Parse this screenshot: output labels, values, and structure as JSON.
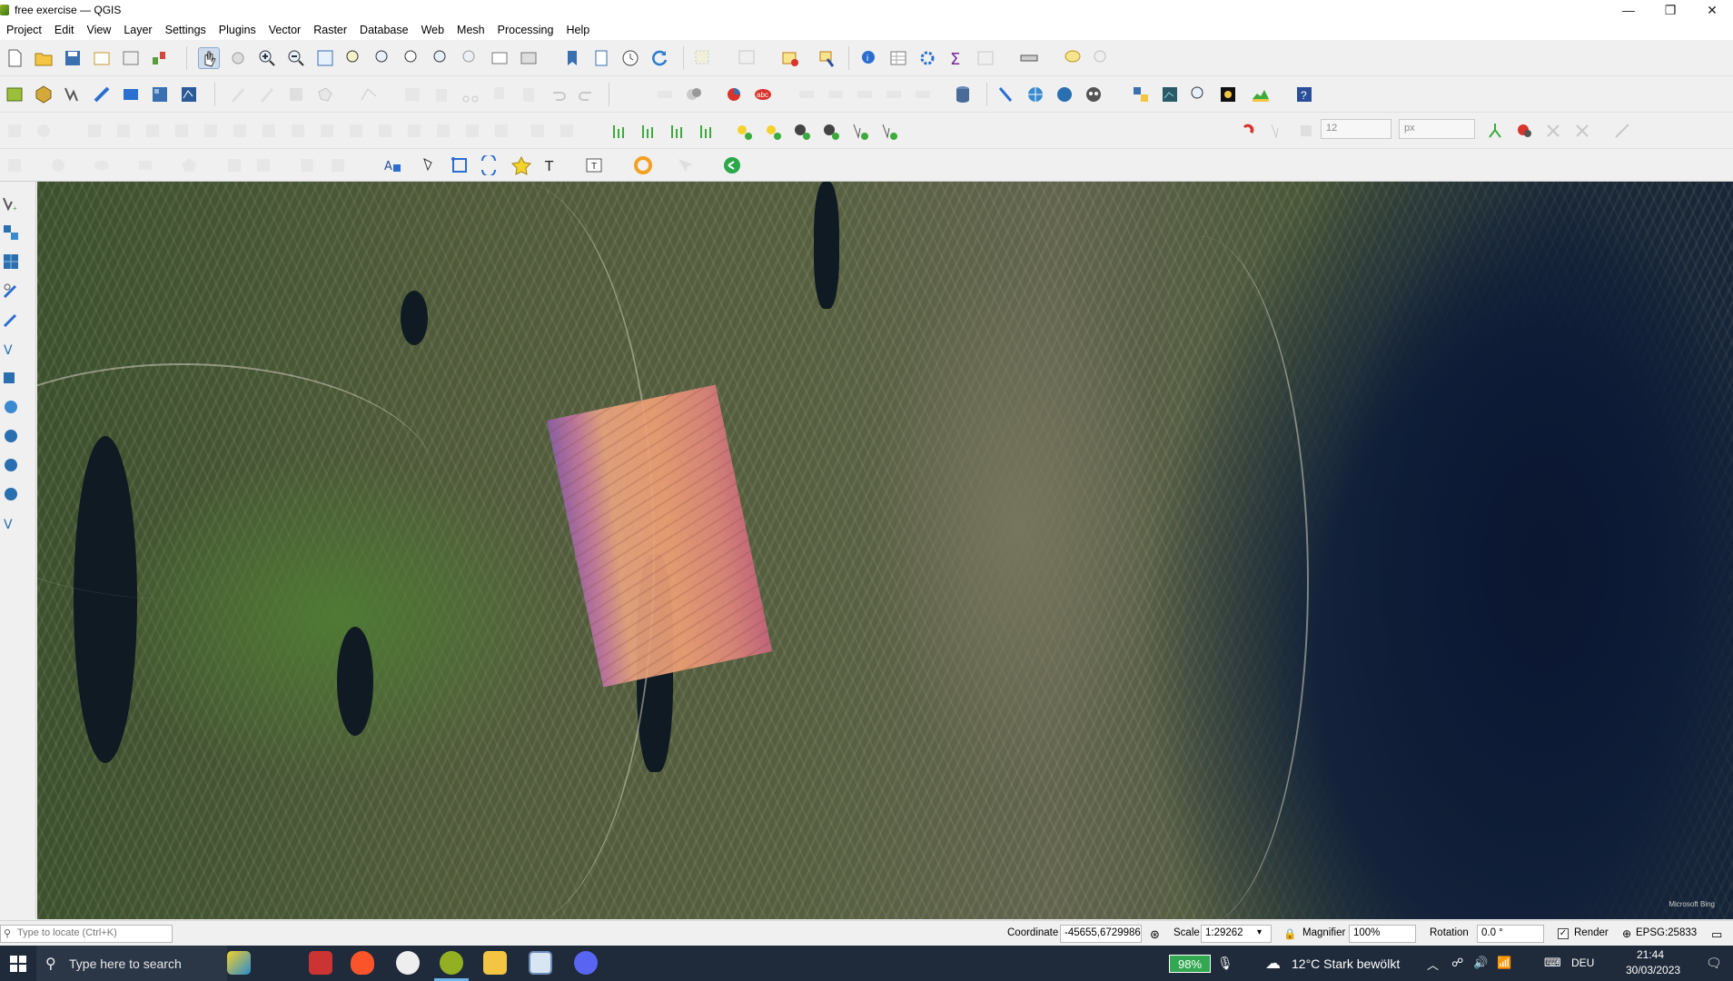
{
  "window": {
    "title": "free exercise — QGIS",
    "minimize": "—",
    "maximize": "❐",
    "close": "✕"
  },
  "menu": [
    "Project",
    "Edit",
    "View",
    "Layer",
    "Settings",
    "Plugins",
    "Vector",
    "Raster",
    "Database",
    "Web",
    "Mesh",
    "Processing",
    "Help"
  ],
  "digitizing": {
    "snap_value": "12",
    "snap_unit": "px"
  },
  "map": {
    "attribution": "Microsoft Bing"
  },
  "status": {
    "locate_placeholder": "Type to locate (Ctrl+K)",
    "coordinate_label": "Coordinate",
    "coordinate_value": "-45655,6729986",
    "scale_label": "Scale",
    "scale_value": "1:29262",
    "magnifier_label": "Magnifier",
    "magnifier_value": "100%",
    "rotation_label": "Rotation",
    "rotation_value": "0.0 °",
    "render_label": "Render",
    "render_checked": true,
    "crs": "EPSG:25833"
  },
  "taskbar": {
    "search_placeholder": "Type here to search",
    "battery": "98%",
    "weather": "12°C  Stark bewölkt",
    "language": "DEU",
    "time": "21:44",
    "date": "30/03/2023"
  },
  "colors": {
    "accent": "#6bb3e8",
    "qgis_green": "#93b023",
    "raster": "#ee9f74",
    "water": "#0f1a2e"
  }
}
